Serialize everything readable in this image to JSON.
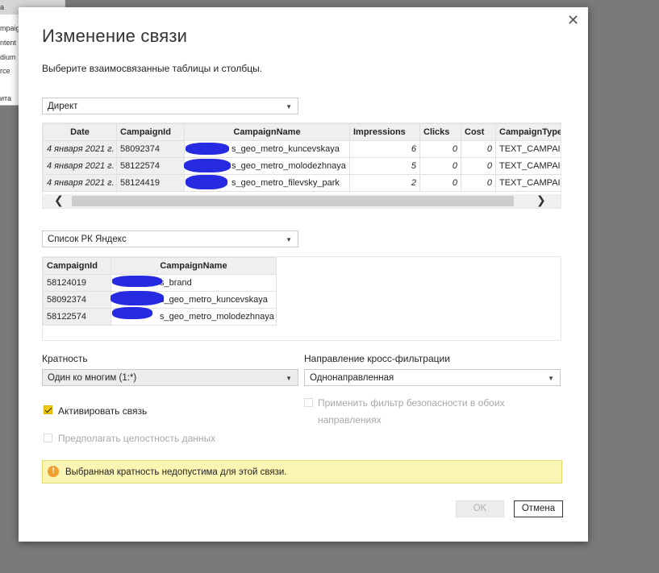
{
  "background_panel": {
    "items": [
      "a",
      "mpaig",
      "ntent",
      "dium",
      "rce",
      "ита"
    ]
  },
  "dialog": {
    "close_glyph": "✕",
    "title": "Изменение связи",
    "subtitle": "Выберите взаимосвязанные таблицы и столбцы."
  },
  "table1": {
    "selected": "Директ",
    "columns": [
      "Date",
      "CampaignId",
      "CampaignName",
      "Impressions",
      "Clicks",
      "Cost",
      "CampaignType"
    ],
    "rows": [
      [
        "4 января 2021 г.",
        "58092374",
        "s_geo_metro_kuncevskaya",
        "6",
        "0",
        "0",
        "TEXT_CAMPAIGN"
      ],
      [
        "4 января 2021 г.",
        "58122574",
        "s_geo_metro_molodezhnaya",
        "5",
        "0",
        "0",
        "TEXT_CAMPAIGN"
      ],
      [
        "4 января 2021 г.",
        "58124419",
        "s_geo_metro_filevsky_park",
        "2",
        "0",
        "0",
        "TEXT_CAMPAIGN"
      ]
    ],
    "scroll_left": "❮",
    "scroll_right": "❯"
  },
  "table2": {
    "selected": "Список РК Яндекс",
    "columns": [
      "CampaignId",
      "CampaignName"
    ],
    "rows": [
      [
        "58124019",
        "s_brand"
      ],
      [
        "58092374",
        "s_geo_metro_kuncevskaya"
      ],
      [
        "58122574",
        "s_geo_metro_molodezhnaya"
      ]
    ]
  },
  "cardinality": {
    "label": "Кратность",
    "value": "Один ко многим (1:*)"
  },
  "cross_filter": {
    "label": "Направление кросс-фильтрации",
    "value": "Однонаправленная"
  },
  "options": {
    "activate": "Активировать связь",
    "activate_checked": true,
    "security_filter": "Применить фильтр безопасности в обоих направлениях",
    "security_line1": "Применить фильтр безопасности в обоих",
    "security_line2": "направлениях",
    "referential": "Предполагать целостность данных"
  },
  "warning": {
    "icon": "!",
    "text": "Выбранная кратность недопустима для этой связи."
  },
  "buttons": {
    "ok": "OK",
    "cancel": "Отмена"
  },
  "colors": {
    "accent_checkbox": "#f2c811",
    "warning_bg": "#fbf5b4",
    "scribble": "#1f24e0"
  }
}
